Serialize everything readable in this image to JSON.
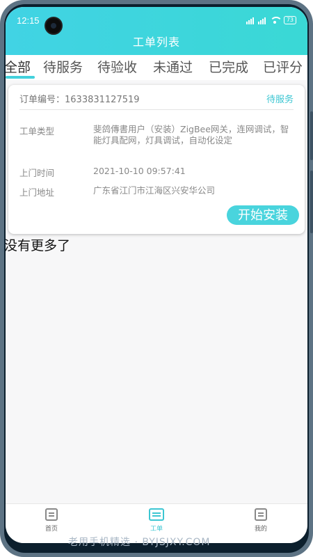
{
  "status_bar": {
    "time": "12:15",
    "battery": "73"
  },
  "header": {
    "title": "工单列表"
  },
  "tabs": [
    {
      "label": "全部"
    },
    {
      "label": "待服务"
    },
    {
      "label": "待验收"
    },
    {
      "label": "未通过"
    },
    {
      "label": "已完成"
    },
    {
      "label": "已评分"
    }
  ],
  "order": {
    "number_label": "订单编号：1633831127519",
    "status": "待服务",
    "type_label": "工单类型",
    "type_value": "斐鸽傳書用户（安装）ZigBee网关，连网调试，智能灯具配网，灯具调试，自动化设定",
    "time_label": "上门时间",
    "time_value": "2021-10-10 09:57:41",
    "address_label": "上门地址",
    "address_value": "广东省江门市江海区兴安华公司",
    "action_label": "开始安装"
  },
  "list_footer": "没有更多了",
  "bottom_nav": [
    {
      "label": "首页"
    },
    {
      "label": "工单"
    },
    {
      "label": "我的"
    }
  ],
  "watermark": "老用手机精选 · BYJSJXY.COM",
  "colors": {
    "accent": "#41d3e4",
    "button": "#49d4dd",
    "status": "#3cc6d2"
  }
}
